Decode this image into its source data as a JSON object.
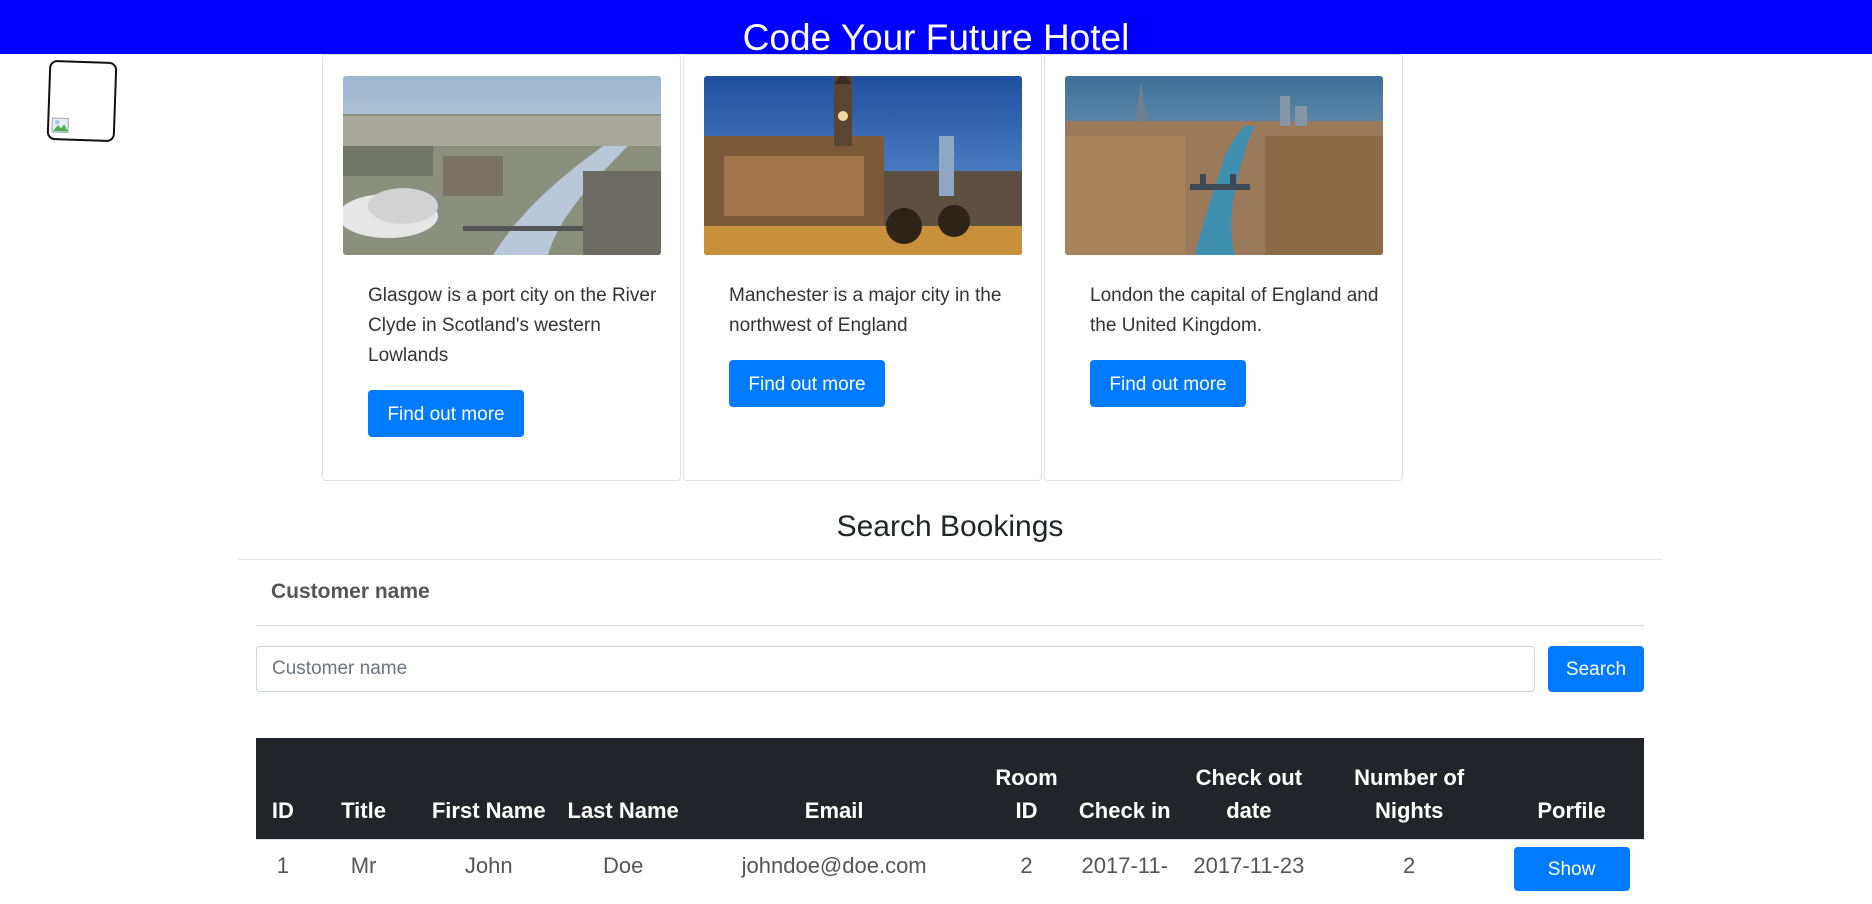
{
  "header": {
    "title": "Code Your Future Hotel"
  },
  "cards": [
    {
      "description": "Glasgow is a port city on the River Clyde in Scotland's western Lowlands",
      "button": "Find out more"
    },
    {
      "description": "Manchester is a major city in the northwest of England",
      "button": "Find out more"
    },
    {
      "description": "London the capital of England and the United Kingdom.",
      "button": "Find out more"
    }
  ],
  "search": {
    "title": "Search Bookings",
    "label": "Customer name",
    "placeholder": "Customer name",
    "button": "Search"
  },
  "table": {
    "headers": [
      "ID",
      "Title",
      "First Name",
      "Last Name",
      "Email",
      "Room ID",
      "Check in",
      "Check out date",
      "Number of Nights",
      "Porfile"
    ],
    "rows": [
      {
        "id": "1",
        "title": "Mr",
        "first_name": "John",
        "last_name": "Doe",
        "email": "johndoe@doe.com",
        "room_id": "2",
        "check_in": "2017-11-",
        "check_out": "2017-11-23",
        "nights": "2",
        "profile_button": "Show"
      }
    ]
  },
  "colors": {
    "header": "#0000ff",
    "primary": "#007bff",
    "table_head": "#212529"
  }
}
